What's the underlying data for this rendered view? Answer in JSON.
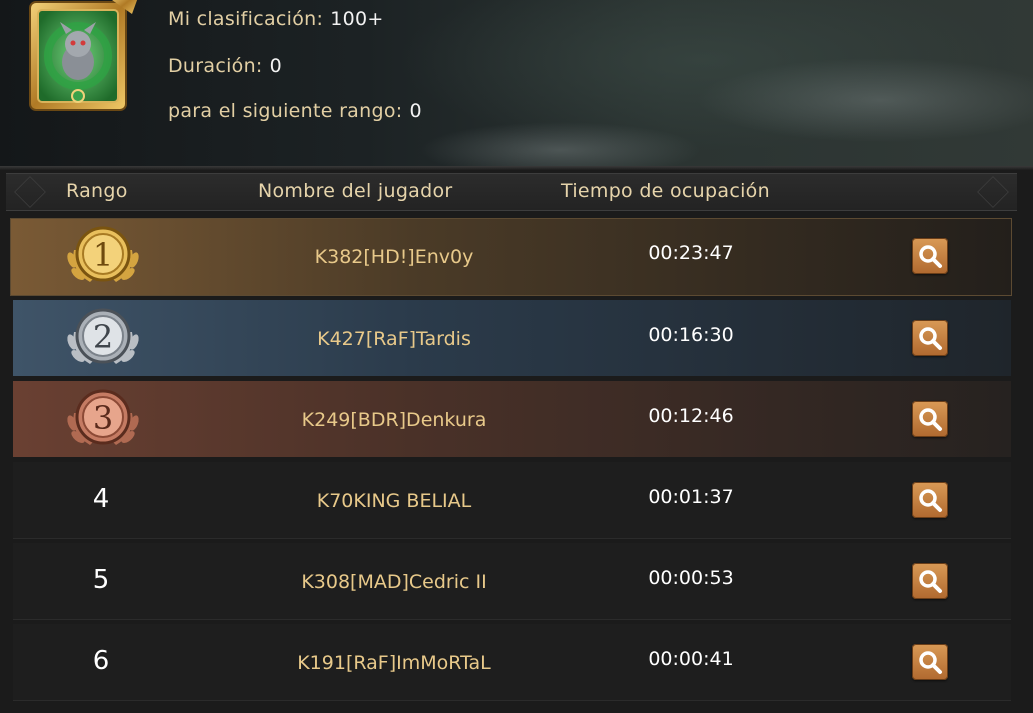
{
  "profile": {
    "avatar": "green-dragon-pet-avatar",
    "ranking_label": "Mi clasificación:",
    "ranking_value": "100+",
    "duration_label": "Duración:",
    "duration_value": "0",
    "next_rank_label": "para el siguiente rango:",
    "next_rank_value": "0"
  },
  "table": {
    "headers": {
      "rank": "Rango",
      "player": "Nombre del jugador",
      "time": "Tiempo de ocupación"
    },
    "rows": [
      {
        "rank": "1",
        "player": "K382[HD!]Env0y",
        "time": "00:23:47",
        "medal": "gold"
      },
      {
        "rank": "2",
        "player": "K427[RaF]Tardis",
        "time": "00:16:30",
        "medal": "silver"
      },
      {
        "rank": "3",
        "player": "K249[BDR]Denkura",
        "time": "00:12:46",
        "medal": "bronze"
      },
      {
        "rank": "4",
        "player": "K70KING BELIAL",
        "time": "00:01:37"
      },
      {
        "rank": "5",
        "player": "K308[MAD]Cedric II",
        "time": "00:00:53"
      },
      {
        "rank": "6",
        "player": "K191[RaF]ImMoRTaL",
        "time": "00:00:41"
      }
    ],
    "action_icon": "magnifier-icon"
  },
  "colors": {
    "gold_text": "#e8c98a",
    "label_text": "#e2cfa4",
    "button": "#c47f3f",
    "gold_medal": "#d4a440",
    "silver_medal": "#b9bec4",
    "bronze_medal": "#b06a52"
  }
}
